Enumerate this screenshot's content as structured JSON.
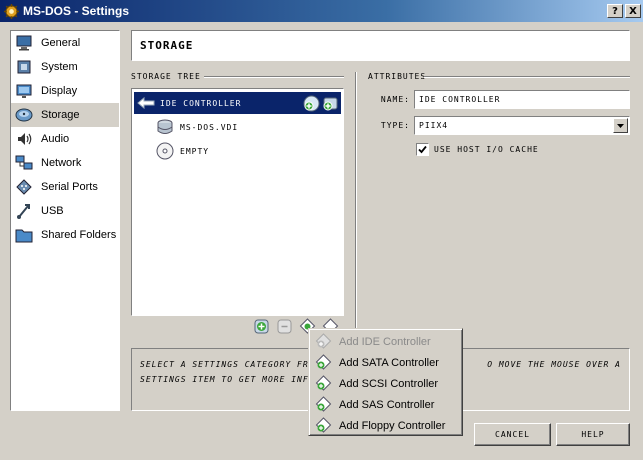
{
  "window": {
    "title": "MS-DOS - Settings",
    "help_glyph": "?",
    "close_glyph": "X"
  },
  "sidebar": {
    "items": [
      {
        "label": "General",
        "icon": "monitor-icon"
      },
      {
        "label": "System",
        "icon": "chip-icon"
      },
      {
        "label": "Display",
        "icon": "display-icon"
      },
      {
        "label": "Storage",
        "icon": "disk-icon",
        "selected": true
      },
      {
        "label": "Audio",
        "icon": "speaker-icon"
      },
      {
        "label": "Network",
        "icon": "network-icon"
      },
      {
        "label": "Serial Ports",
        "icon": "serial-port-icon"
      },
      {
        "label": "USB",
        "icon": "usb-icon"
      },
      {
        "label": "Shared Folders",
        "icon": "folder-icon"
      }
    ]
  },
  "page": {
    "title": "STORAGE"
  },
  "storage_tree": {
    "label": "STORAGE TREE",
    "controller": "IDE CONTROLLER",
    "items": [
      "MS-DOS.VDI",
      "EMPTY"
    ]
  },
  "attributes": {
    "label": "ATTRIBUTES",
    "name_label": "NAME:",
    "name_value": "IDE CONTROLLER",
    "type_label": "TYPE:",
    "type_value": "PIIX4",
    "cache_label": "USE HOST I/O CACHE",
    "cache_checked": true
  },
  "description": {
    "line1_left": "SELECT A SETTINGS CATEGORY FROM T",
    "line1_right": "O MOVE THE MOUSE OVER A",
    "line2_left": "SETTINGS ITEM TO GET MORE INFORMA"
  },
  "buttons": {
    "cancel": "CANCEL",
    "help": "HELP"
  },
  "context_menu": {
    "items": [
      {
        "label": "Add IDE Controller",
        "disabled": true
      },
      {
        "label": "Add SATA Controller"
      },
      {
        "label": "Add SCSI Controller"
      },
      {
        "label": "Add SAS Controller"
      },
      {
        "label": "Add Floppy Controller"
      }
    ]
  },
  "colors": {
    "selection": "#0a246a",
    "window_bg": "#d4d0c8",
    "accent_green": "#3aa63a"
  }
}
